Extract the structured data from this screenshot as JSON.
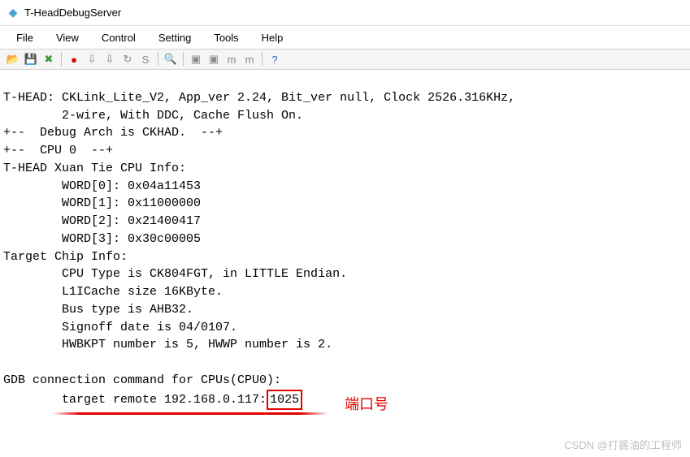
{
  "window": {
    "title": "T-HeadDebugServer"
  },
  "menu": {
    "file": "File",
    "view": "View",
    "control": "Control",
    "setting": "Setting",
    "tools": "Tools",
    "help": "Help"
  },
  "toolbar": {
    "open": "📂",
    "save": "💾",
    "delete": "✖",
    "record": "●",
    "dl1": "⇩",
    "dl2": "⇩",
    "refresh": "↻",
    "stop": "S",
    "find": "🔍",
    "win1": "▣",
    "win2": "▣",
    "mem": "m",
    "mem2": "m",
    "help": "?"
  },
  "console": {
    "line1": "T-HEAD: CKLink_Lite_V2, App_ver 2.24, Bit_ver null, Clock 2526.316KHz,",
    "line2": "        2-wire, With DDC, Cache Flush On.",
    "line3": "+--  Debug Arch is CKHAD.  --+",
    "line4": "+--  CPU 0  --+",
    "line5": "T-HEAD Xuan Tie CPU Info:",
    "line6": "        WORD[0]: 0x04a11453",
    "line7": "        WORD[1]: 0x11000000",
    "line8": "        WORD[2]: 0x21400417",
    "line9": "        WORD[3]: 0x30c00005",
    "line10": "Target Chip Info:",
    "line11": "        CPU Type is CK804FGT, in LITTLE Endian.",
    "line12": "        L1ICache size 16KByte.",
    "line13": "        Bus type is AHB32.",
    "line14": "        Signoff date is 04/0107.",
    "line15": "        HWBKPT number is 5, HWWP number is 2.",
    "line16": "",
    "line17": "GDB connection command for CPUs(CPU0):",
    "gdb_prefix": "        target remote 192.168.0.117:",
    "gdb_port": "1025"
  },
  "annotation": {
    "label": "端口号"
  },
  "watermark": {
    "text": "CSDN @打酱油的工程师"
  }
}
